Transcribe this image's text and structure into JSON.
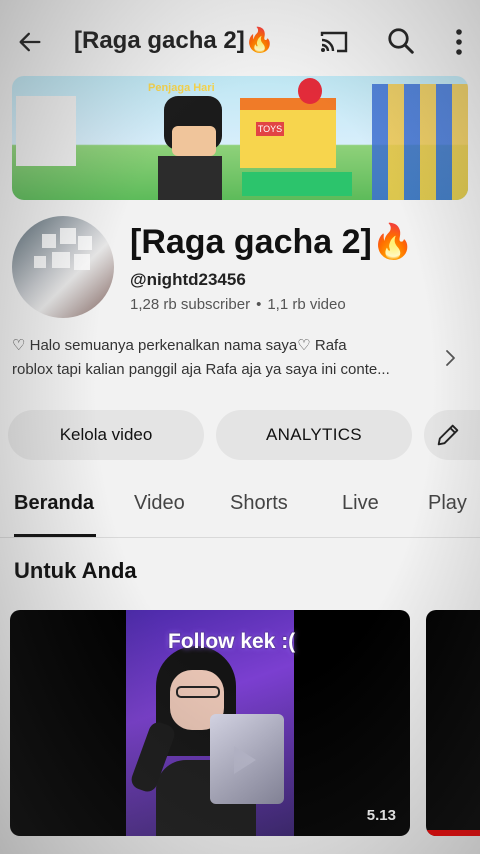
{
  "header": {
    "title": "[Raga gacha 2]🔥"
  },
  "channel": {
    "name": "[Raga gacha 2]🔥",
    "handle": "@nightd23456",
    "subscribers": "1,28 rb subscriber",
    "separator": "•",
    "videos": "1,1 rb video",
    "description_line1": "♡ Halo semuanya perkenalkan nama saya♡ Rafa",
    "description_line2": "roblox  tapi kalian panggil aja Rafa aja ya saya ini conte..."
  },
  "banner": {
    "tag": "Penjaga Hari",
    "shop_sign": "TOYS"
  },
  "actions": {
    "manage_label": "Kelola video",
    "analytics_label": "ANALYTICS"
  },
  "tabs": [
    {
      "label": "Beranda",
      "active": true
    },
    {
      "label": "Video",
      "active": false
    },
    {
      "label": "Shorts",
      "active": false
    },
    {
      "label": "Live",
      "active": false
    },
    {
      "label": "Play",
      "active": false
    }
  ],
  "section": {
    "title": "Untuk Anda"
  },
  "videos": [
    {
      "overlay_text": "Follow kek :(",
      "duration": "5.13"
    }
  ],
  "icons": {
    "back": "arrow-left-icon",
    "cast": "cast-icon",
    "search": "search-icon",
    "more": "more-vert-icon",
    "chevron": "chevron-right-icon",
    "edit": "pencil-icon"
  },
  "colors": {
    "background": "#f2f2f2",
    "chip": "#e4e4e4",
    "text": "#0f0f0f",
    "secondary_text": "#555555"
  }
}
